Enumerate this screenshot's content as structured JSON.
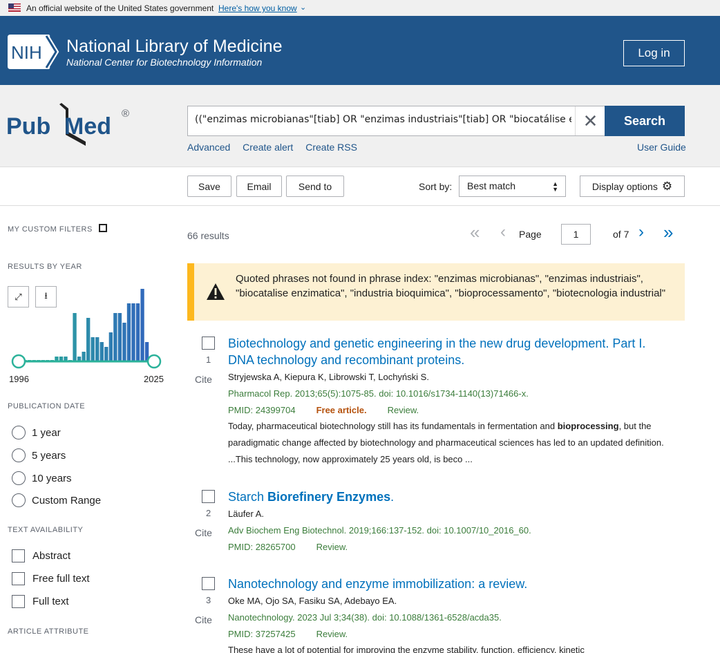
{
  "gov_banner": {
    "text": "An official website of the United States government",
    "link": "Here's how you know"
  },
  "header": {
    "logo_text": "NIH",
    "title": "National Library of Medicine",
    "subtitle": "National Center for Biotechnology Information",
    "login_label": "Log in",
    "brand_color": "#20558a"
  },
  "search": {
    "logo_text_1": "Pub",
    "logo_text_2": "Med",
    "logo_mark": "®",
    "query": "((\"enzimas microbianas\"[tiab] OR \"enzimas industriais\"[tiab] OR \"biocatálise e",
    "button_label": "Search",
    "links": [
      "Advanced",
      "Create alert",
      "Create RSS"
    ],
    "user_guide": "User Guide"
  },
  "toolbar": {
    "save": "Save",
    "email": "Email",
    "send_to": "Send to",
    "sort_label": "Sort by:",
    "sort_value": "Best match",
    "display_options": "Display options"
  },
  "sidebar": {
    "custom_filters": "MY CUSTOM FILTERS",
    "results_by_year": "RESULTS BY YEAR",
    "year_start": "1996",
    "year_end": "2025",
    "publication_date": "PUBLICATION DATE",
    "date_options": [
      "1 year",
      "5 years",
      "10 years",
      "Custom Range"
    ],
    "text_availability": "TEXT AVAILABILITY",
    "text_options": [
      "Abstract",
      "Free full text",
      "Full text"
    ],
    "article_attribute": "ARTICLE ATTRIBUTE"
  },
  "chart_data": {
    "type": "bar",
    "title": "",
    "xlabel": "",
    "ylabel": "",
    "x_range": [
      "1996",
      "2025"
    ],
    "values": [
      1,
      0,
      0,
      0,
      0,
      0,
      0,
      0,
      1,
      1,
      1,
      0,
      10,
      1,
      2,
      9,
      5,
      5,
      4,
      3,
      6,
      10,
      10,
      8,
      12,
      12,
      12,
      15,
      4,
      1
    ]
  },
  "results": {
    "count": "66 results",
    "page_label": "Page",
    "page": "1",
    "of_pages": "of 7",
    "alert": "Quoted phrases not found in phrase index: \"enzimas microbianas\", \"enzimas industriais\", \"biocatalise enzimatica\", \"industria bioquimica\", \"bioprocessamento\", \"biotecnologia industrial\"",
    "cite_label": "Cite",
    "items": [
      {
        "num": "1",
        "title": "Biotechnology and genetic engineering in the new drug development. Part I. DNA technology and recombinant proteins.",
        "authors": "Stryjewska A, Kiepura K, Librowski T, Lochyński S.",
        "citation": "Pharmacol Rep. 2013;65(5):1075-85. doi: 10.1016/s1734-1140(13)71466-x.",
        "pmid": "PMID: 24399704",
        "free": "Free article.",
        "type": "Review.",
        "snippet_1": "Today, pharmaceutical biotechnology still has its fundamentals in fermentation and ",
        "snippet_bold": "bioprocessing",
        "snippet_2": ", but the paradigmatic change affected by biotechnology and pharmaceutical sciences has led to an updated definition. ...This technology, now approximately 25 years old, is beco ..."
      },
      {
        "num": "2",
        "title_plain": "Starch ",
        "title_bold": "Biorefinery Enzymes",
        "title_end": ".",
        "authors": "Läufer A.",
        "citation": "Adv Biochem Eng Biotechnol. 2019;166:137-152. doi: 10.1007/10_2016_60.",
        "pmid": "PMID: 28265700",
        "type": "Review."
      },
      {
        "num": "3",
        "title": "Nanotechnology and enzyme immobilization: a review.",
        "authors": "Oke MA, Ojo SA, Fasiku SA, Adebayo EA.",
        "citation": "Nanotechnology. 2023 Jul 3;34(38). doi: 10.1088/1361-6528/acda35.",
        "pmid": "PMID: 37257425",
        "type": "Review.",
        "snippet": "These have a lot of potential for improving the enzyme stability, function, efficiency, kinetic"
      }
    ]
  }
}
